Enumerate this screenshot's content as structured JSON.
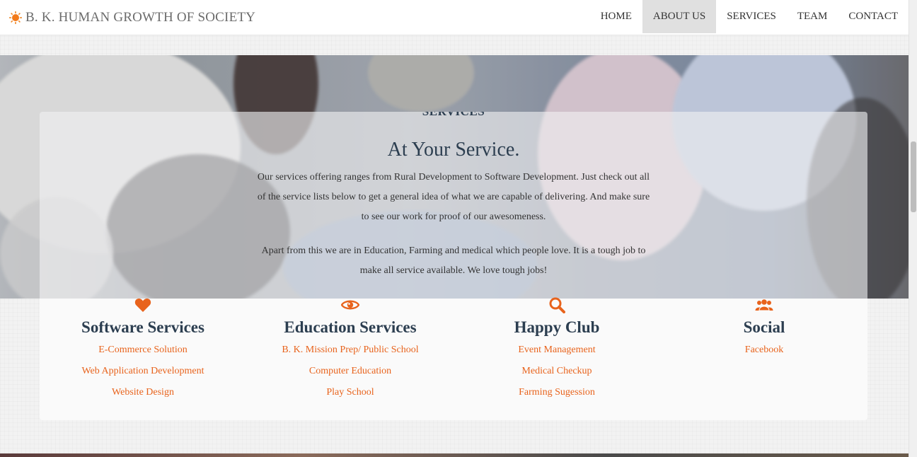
{
  "navbar": {
    "brand": "B. K. HUMAN GROWTH OF SOCIETY",
    "brand_icon": "sun-icon",
    "items": [
      {
        "label": "HOME",
        "active": false
      },
      {
        "label": "ABOUT US",
        "active": true
      },
      {
        "label": "SERVICES",
        "active": false
      },
      {
        "label": "TEAM",
        "active": false
      },
      {
        "label": "CONTACT",
        "active": false
      }
    ]
  },
  "services": {
    "section_label": "SERVICES",
    "headline": "At Your Service.",
    "paragraph1": "Our services offering ranges from Rural Development to Software Development. Just check out all of the service lists below to get a general idea of what we are capable of delivering. And make sure to see our work for proof of our awesomeness.",
    "paragraph2": "Apart from this we are in Education, Farming and medical which people love. It is a tough job to make all service available. We love tough jobs!",
    "columns": [
      {
        "icon": "heart-icon",
        "title": "Software Services",
        "links": [
          "E-Commerce Solution",
          "Web Application Development",
          "Website Design"
        ]
      },
      {
        "icon": "eye-icon",
        "title": "Education Services",
        "links": [
          "B. K. Mission Prep/ Public School",
          "Computer Education",
          "Play School"
        ]
      },
      {
        "icon": "search-icon",
        "title": "Happy Club",
        "links": [
          "Event Management",
          "Medical Checkup",
          "Farming Sugession"
        ]
      },
      {
        "icon": "users-icon",
        "title": "Social",
        "links": [
          "Facebook"
        ]
      }
    ]
  },
  "colors": {
    "accent": "#e8631c",
    "heading": "#2c3e50",
    "nav_active_bg": "#e0e0e0"
  }
}
